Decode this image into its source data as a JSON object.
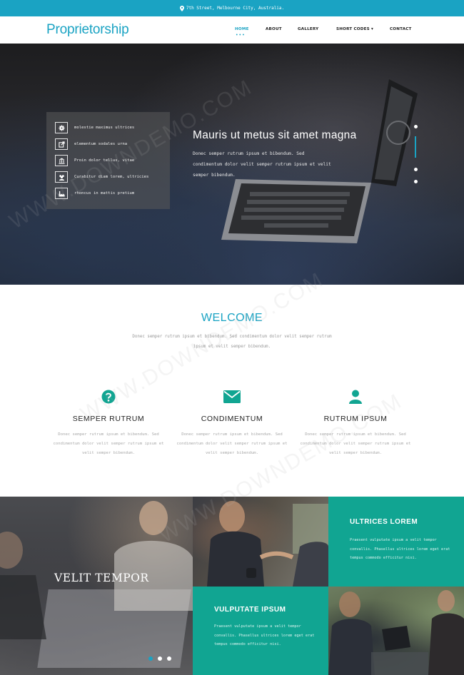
{
  "topbar": {
    "address": "7th Street, Melbourne City, Australia."
  },
  "nav": {
    "logo": "Proprietorship",
    "items": [
      "HOME",
      "ABOUT",
      "GALLERY",
      "SHORT CODES",
      "CONTACT"
    ],
    "active_index": 0
  },
  "hero": {
    "features": [
      {
        "icon": "gear-icon",
        "label": "molestie maximus ultrices"
      },
      {
        "icon": "external-link-icon",
        "label": "elementum sodales urna"
      },
      {
        "icon": "bank-icon",
        "label": "Proin dolor tellus, vitae"
      },
      {
        "icon": "users-icon",
        "label": "Curabitur diam lorem, ultricies"
      },
      {
        "icon": "industry-icon",
        "label": "rhoncus in mattis pretium"
      }
    ],
    "title": "Mauris ut metus sit amet magna",
    "text": "Donec semper rutrum ipsum et bibendum. Sed condimentum dolor velit semper rutrum ipsum et velit semper bibendum.",
    "slide_count": 4,
    "active_slide": 1
  },
  "welcome": {
    "title": "WELCOME",
    "text": "Donec semper rutrum ipsum et bibendum. Sed condimentum dolor velit semper rutrum ipsum et velit semper bibendum."
  },
  "services": [
    {
      "icon": "question-circle-icon",
      "title": "SEMPER RUTRUM",
      "text": "Donec semper rutrum ipsum et bibendum. Sed condimentum dolor velit semper rutrum ipsum et velit semper bibendum."
    },
    {
      "icon": "envelope-icon",
      "title": "CONDIMENTUM",
      "text": "Donec semper rutrum ipsum et bibendum. Sed condimentum dolor velit semper rutrum ipsum et velit semper bibendum."
    },
    {
      "icon": "user-icon",
      "title": "RUTRUM IPSUM",
      "text": "Donec semper rutrum ipsum et bibendum. Sed condimentum dolor velit semper rutrum ipsum et velit semper bibendum."
    }
  ],
  "bottom": {
    "left_caption": "VELIT TEMPOR",
    "carousel_dots": 3,
    "carousel_active": 0,
    "block1": {
      "title": "ULTRICES LOREM",
      "text": "Praesent vulputate ipsum a velit tempor convallis. Phasellus ultrices lorem eget erat tempus commodo efficitur nisi."
    },
    "block2": {
      "title": "VULPUTATE IPSUM",
      "text": "Praesent vulputate ipsum a velit tempor convallis. Phasellus ultrices lorem eget erat tempus commodo efficitur nisi."
    }
  },
  "watermark": "WWW.DOWNDEMO.COM",
  "colors": {
    "accent": "#1aa3c3",
    "teal": "#11a592"
  }
}
